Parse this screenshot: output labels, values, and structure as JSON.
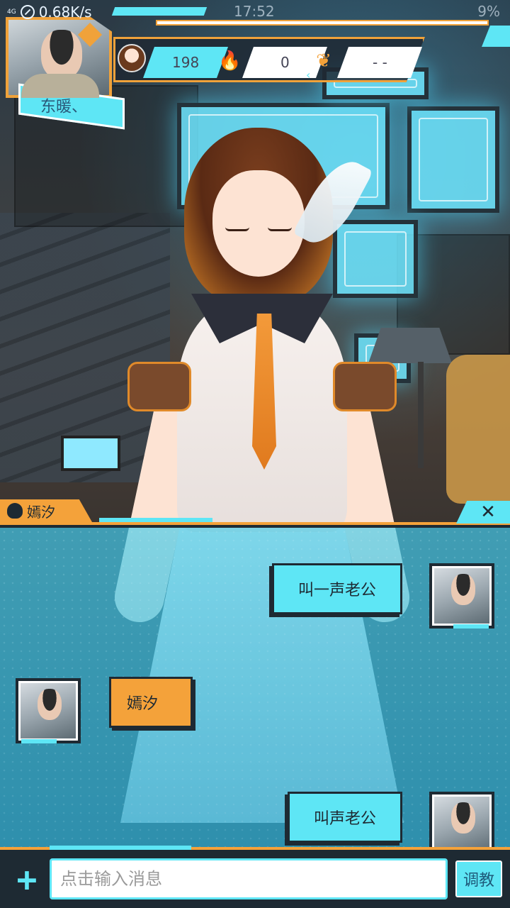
{
  "status_bar": {
    "network_tag": "4G",
    "speed": "0.68K/s",
    "time": "17:52",
    "battery": "9%"
  },
  "profile": {
    "name": "东暖、"
  },
  "hud": {
    "stat_1": "198",
    "stat_2": "0",
    "stat_3": "- -"
  },
  "character": {
    "name": "嫣汐"
  },
  "chat": {
    "messages": [
      {
        "side": "right",
        "text": "叫一声老公"
      },
      {
        "side": "left",
        "text": "嫣汐"
      },
      {
        "side": "right",
        "text": "叫声老公"
      }
    ]
  },
  "input": {
    "placeholder": "点击输入消息",
    "train_label": "调教",
    "plus_label": "+",
    "close_label": "✕"
  },
  "colors": {
    "accent_cyan": "#5ee6f5",
    "accent_orange": "#f4a23a",
    "dark": "#1e2a33"
  }
}
